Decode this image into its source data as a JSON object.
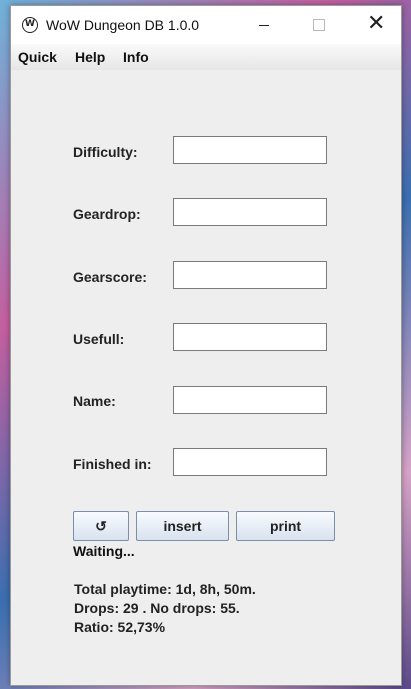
{
  "window": {
    "title": "WoW Dungeon DB 1.0.0",
    "icon": "W",
    "close_glyph": "✕"
  },
  "menu": [
    "Quick",
    "Help",
    "Info"
  ],
  "fields": [
    {
      "label": "Difficulty:",
      "value": ""
    },
    {
      "label": "Geardrop:",
      "value": ""
    },
    {
      "label": "Gearscore:",
      "value": ""
    },
    {
      "label": "Usefull:",
      "value": ""
    },
    {
      "label": "Name:",
      "value": ""
    },
    {
      "label": "Finished in:",
      "value": ""
    }
  ],
  "buttons": {
    "refresh": "↺",
    "insert": "insert",
    "print": "print"
  },
  "status": "Waiting...",
  "stats": {
    "playtime": "Total playtime: 1d, 8h, 50m.",
    "drops": "Drops: 29 . No drops: 55.",
    "ratio": "Ratio: 52,73%"
  }
}
